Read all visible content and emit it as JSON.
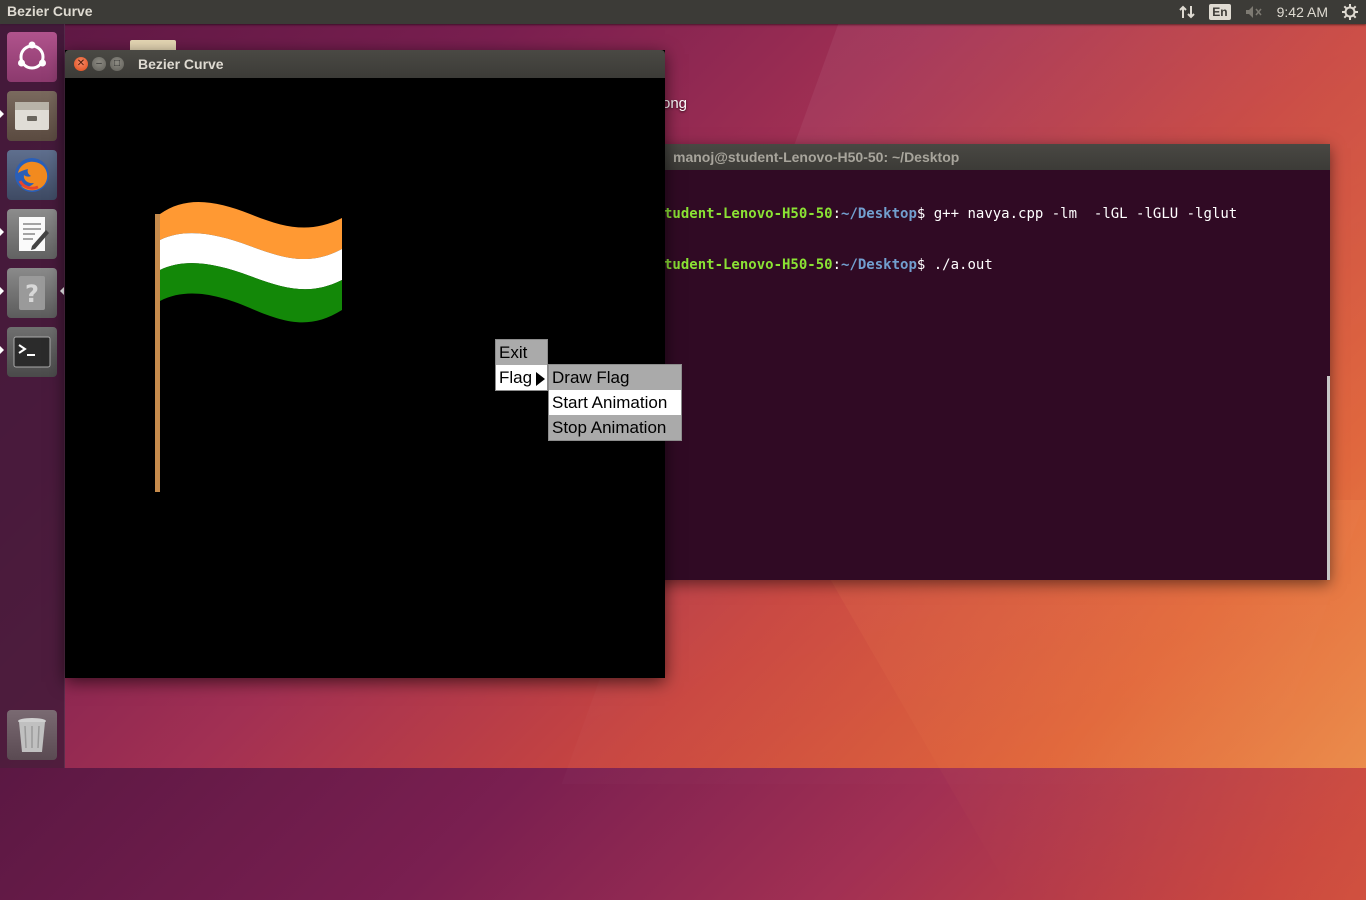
{
  "top_panel": {
    "app_title": "Bezier Curve",
    "language": "En",
    "clock": "9:42 AM"
  },
  "launcher": {
    "items": [
      {
        "name": "dash"
      },
      {
        "name": "files"
      },
      {
        "name": "firefox"
      },
      {
        "name": "text-editor"
      },
      {
        "name": "help"
      },
      {
        "name": "terminal"
      },
      {
        "name": "trash"
      }
    ]
  },
  "desktop": {
    "partial_label": "ong"
  },
  "terminal": {
    "title": "manoj@student-Lenovo-H50-50: ~/Desktop",
    "lines": [
      {
        "user": "tudent-Lenovo-H50-50",
        "sep": ":",
        "path": "~/Desktop",
        "prompt": "$",
        "cmd": " g++ navya.cpp -lm  -lGL -lGLU -lglut"
      },
      {
        "user": "tudent-Lenovo-H50-50",
        "sep": ":",
        "path": "~/Desktop",
        "prompt": "$",
        "cmd": " ./a.out"
      }
    ]
  },
  "bezier_window": {
    "title": "Bezier Curve",
    "flag_colors": {
      "saffron": "#ff9933",
      "white": "#ffffff",
      "green": "#138808",
      "pole": "#c68b4c"
    }
  },
  "glut_menu": {
    "main": [
      "Exit",
      "Flag"
    ],
    "submenu": [
      "Draw Flag",
      "Start Animation",
      "Stop Animation"
    ]
  },
  "colors": {
    "terminal_bg": "#300a24",
    "terminal_user": "#8ae234",
    "terminal_path": "#729fcf",
    "panel_bg": "#3c3b37"
  }
}
